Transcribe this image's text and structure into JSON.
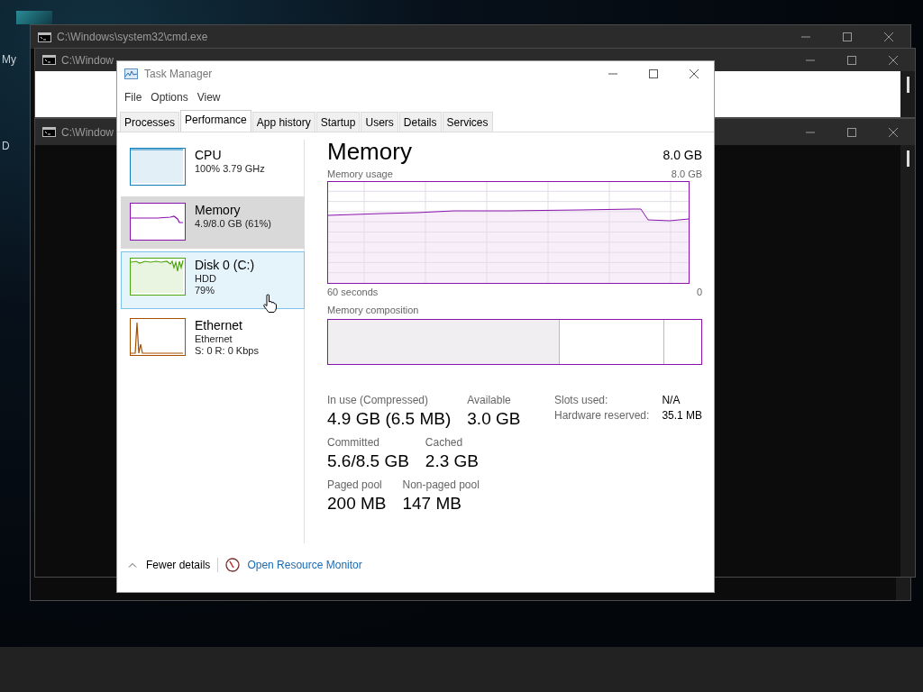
{
  "desktop": {
    "icons": [
      {
        "label": "My"
      },
      {
        "label": "D"
      }
    ]
  },
  "background_windows": [
    {
      "title": "C:\\Windows\\system32\\cmd.exe",
      "kind": "console"
    },
    {
      "title": "C:\\Window",
      "kind": "blank"
    },
    {
      "title": "C:\\Window",
      "kind": "console"
    }
  ],
  "window": {
    "title": "Task Manager"
  },
  "menu": [
    "File",
    "Options",
    "View"
  ],
  "tabs": [
    {
      "label": "Processes",
      "selected": false
    },
    {
      "label": "Performance",
      "selected": true
    },
    {
      "label": "App history",
      "selected": false
    },
    {
      "label": "Startup",
      "selected": false
    },
    {
      "label": "Users",
      "selected": false
    },
    {
      "label": "Details",
      "selected": false
    },
    {
      "label": "Services",
      "selected": false
    }
  ],
  "sidebar": {
    "items": [
      {
        "kind": "cpu",
        "name": "CPU",
        "lines": [
          "100% 3.79 GHz"
        ],
        "color": "#117dbb",
        "selected": false,
        "hovered": false
      },
      {
        "kind": "memory",
        "name": "Memory",
        "lines": [
          "4.9/8.0 GB (61%)"
        ],
        "color": "#8b12ae",
        "selected": true,
        "hovered": false
      },
      {
        "kind": "disk",
        "name": "Disk 0 (C:)",
        "lines": [
          "HDD",
          "79%"
        ],
        "color": "#4da60c",
        "selected": false,
        "hovered": true
      },
      {
        "kind": "ethernet",
        "name": "Ethernet",
        "lines": [
          "Ethernet",
          "S: 0 R: 0 Kbps"
        ],
        "color": "#a74f01",
        "selected": false,
        "hovered": false
      }
    ]
  },
  "detail": {
    "title": "Memory",
    "total": "8.0 GB",
    "usage_graph": {
      "label": "Memory usage",
      "max": "8.0 GB",
      "time_span": "60 seconds",
      "end": "0"
    },
    "composition": {
      "label": "Memory composition"
    },
    "stat_rows": [
      {
        "items": [
          {
            "label": "In use (Compressed)",
            "value": "4.9 GB (6.5 MB)"
          },
          {
            "label": "Available",
            "value": "3.0 GB"
          }
        ]
      },
      {
        "items": [
          {
            "label": "Committed",
            "value": "5.6/8.5 GB"
          },
          {
            "label": "Cached",
            "value": "2.3 GB"
          }
        ]
      },
      {
        "items": [
          {
            "label": "Paged pool",
            "value": "200 MB"
          },
          {
            "label": "Non-paged pool",
            "value": "147 MB"
          }
        ]
      }
    ],
    "hardware": [
      {
        "label": "Slots used:",
        "value": "N/A"
      },
      {
        "label": "Hardware reserved:",
        "value": "35.1 MB"
      }
    ]
  },
  "footer": {
    "toggle": "Fewer details",
    "link": "Open Resource Monitor"
  }
}
